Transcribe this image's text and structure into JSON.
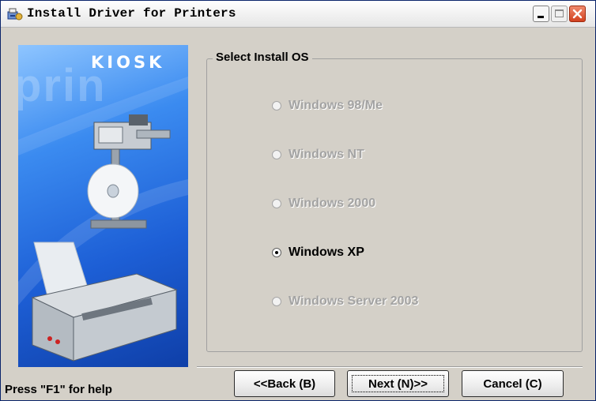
{
  "window": {
    "title": "Install Driver for Printers",
    "icon": "installer-icon",
    "controls": [
      "minimize-icon",
      "maximize-icon",
      "close-icon"
    ]
  },
  "banner": {
    "brand": "KIOSK",
    "watermark": "prin"
  },
  "group": {
    "legend": "Select Install OS",
    "options": [
      {
        "label": "Windows 98/Me",
        "enabled": false,
        "selected": false
      },
      {
        "label": "Windows NT",
        "enabled": false,
        "selected": false
      },
      {
        "label": "Windows 2000",
        "enabled": false,
        "selected": false
      },
      {
        "label": "Windows XP",
        "enabled": true,
        "selected": true
      },
      {
        "label": "Windows Server 2003",
        "enabled": false,
        "selected": false
      }
    ]
  },
  "help_text": "Press \"F1\" for help",
  "buttons": {
    "back": "<<Back (B)",
    "next": "Next (N)>>",
    "cancel": "Cancel (C)"
  },
  "colors": {
    "title_accent": "#d2401f",
    "banner_blue": "#1d5fd6",
    "dialog_bg": "#d4d0c8",
    "disabled_text": "#a3a3a3"
  }
}
